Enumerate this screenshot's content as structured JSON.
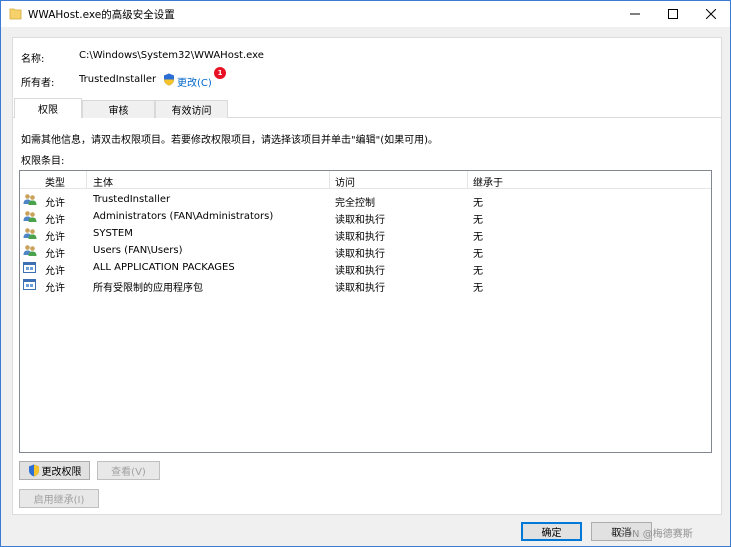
{
  "window": {
    "title": "WWAHost.exe的高级安全设置"
  },
  "info": {
    "name_label": "名称:",
    "name_value": "C:\\Windows\\System32\\WWAHost.exe",
    "owner_label": "所有者:",
    "owner_value": "TrustedInstaller",
    "change_link": "更改(C)",
    "badge": "1"
  },
  "tabs": [
    {
      "label": "权限",
      "active": true
    },
    {
      "label": "审核",
      "active": false
    },
    {
      "label": "有效访问",
      "active": false
    }
  ],
  "hint": "如需其他信息，请双击权限项目。若要修改权限项目，请选择该项目并单击\"编辑\"(如果可用)。",
  "entries_label": "权限条目:",
  "table": {
    "columns": [
      "类型",
      "主体",
      "访问",
      "继承于"
    ],
    "rows": [
      {
        "type": "允许",
        "principal": "TrustedInstaller",
        "access": "完全控制",
        "inherited": "无",
        "icon": "users-icon"
      },
      {
        "type": "允许",
        "principal": "Administrators (FAN\\Administrators)",
        "access": "读取和执行",
        "inherited": "无",
        "icon": "users-icon"
      },
      {
        "type": "允许",
        "principal": "SYSTEM",
        "access": "读取和执行",
        "inherited": "无",
        "icon": "users-icon"
      },
      {
        "type": "允许",
        "principal": "Users (FAN\\Users)",
        "access": "读取和执行",
        "inherited": "无",
        "icon": "users-icon"
      },
      {
        "type": "允许",
        "principal": "ALL APPLICATION PACKAGES",
        "access": "读取和执行",
        "inherited": "无",
        "icon": "app-package-icon"
      },
      {
        "type": "允许",
        "principal": "所有受限制的应用程序包",
        "access": "读取和执行",
        "inherited": "无",
        "icon": "app-package-icon"
      }
    ]
  },
  "buttons": {
    "change_permissions": "更改权限",
    "view": "查看(V)",
    "enable_inheritance": "启用继承(I)",
    "ok": "确定",
    "cancel": "取消"
  },
  "watermark": "CSDN @梅德赛斯"
}
